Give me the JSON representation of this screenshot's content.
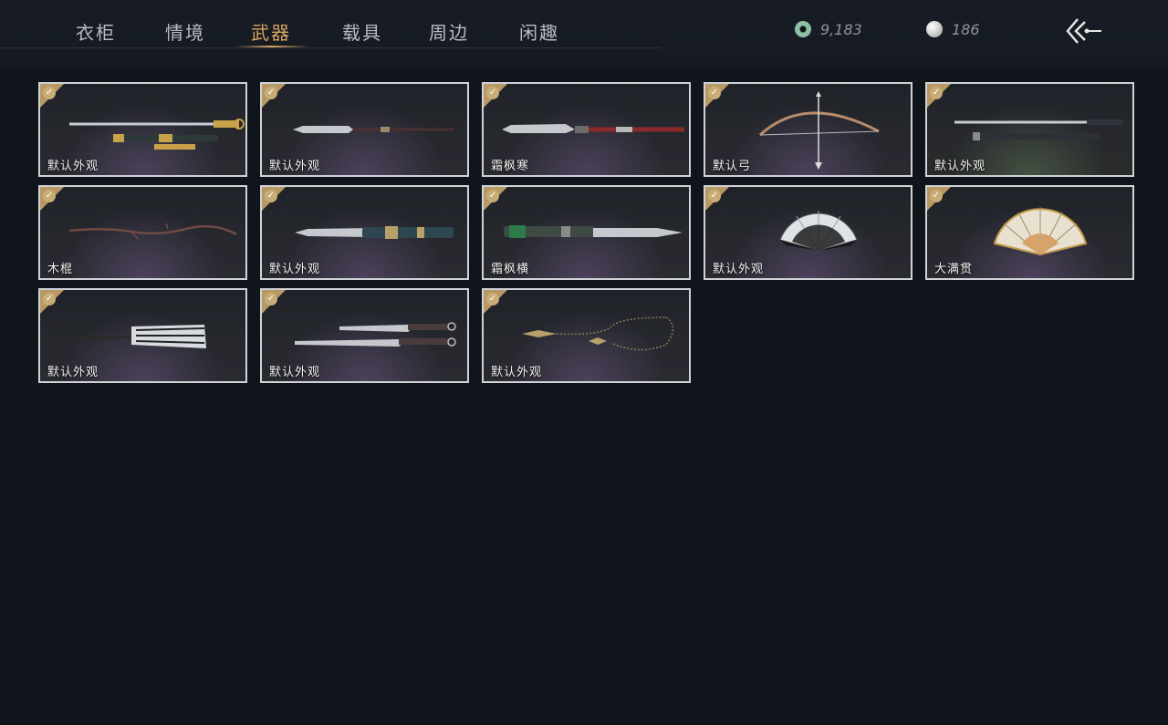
{
  "tabs": [
    {
      "label": "衣柜"
    },
    {
      "label": "情境"
    },
    {
      "label": "武器"
    },
    {
      "label": "载具"
    },
    {
      "label": "周边"
    },
    {
      "label": "闲趣"
    }
  ],
  "active_tab": "武器",
  "currency": {
    "jade": {
      "value": "9,183",
      "icon": "jade-coin-icon"
    },
    "pearl": {
      "value": "186",
      "icon": "pearl-icon"
    }
  },
  "back_icon": "back-arrow-icon",
  "accent_color": "#d9a561",
  "items": [
    {
      "label": "默认外观",
      "icon": "sword-icon",
      "owned": true
    },
    {
      "label": "默认外观",
      "icon": "spear-icon",
      "owned": true
    },
    {
      "label": "霜枫寒",
      "icon": "glaive-icon",
      "owned": true
    },
    {
      "label": "默认弓",
      "icon": "bow-icon",
      "owned": true
    },
    {
      "label": "默认外观",
      "icon": "sword-icon",
      "owned": true
    },
    {
      "label": "木棍",
      "icon": "staff-icon",
      "owned": true
    },
    {
      "label": "默认外观",
      "icon": "blade-icon",
      "owned": true
    },
    {
      "label": "霜枫横",
      "icon": "blade-icon",
      "owned": true
    },
    {
      "label": "默认外观",
      "icon": "fan-icon",
      "owned": true
    },
    {
      "label": "大满贯",
      "icon": "fan-icon",
      "owned": true
    },
    {
      "label": "默认外观",
      "icon": "umbrella-icon",
      "owned": true
    },
    {
      "label": "默认外观",
      "icon": "dual-blades-icon",
      "owned": true
    },
    {
      "label": "默认外观",
      "icon": "rope-dart-icon",
      "owned": true
    }
  ]
}
